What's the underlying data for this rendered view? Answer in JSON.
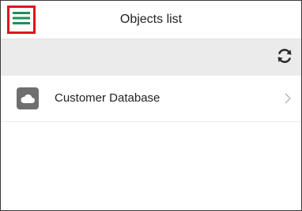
{
  "header": {
    "title": "Objects list"
  },
  "toolbar": {
    "refresh_icon": "refresh-icon"
  },
  "list": {
    "items": [
      {
        "label": "Customer Database",
        "icon": "cloud-icon"
      }
    ]
  },
  "colors": {
    "menu_icon": "#1e8f57",
    "highlight_border": "#e0141c",
    "toolbar_bg": "#ebebeb",
    "db_icon_bg": "#6f6f6f"
  }
}
